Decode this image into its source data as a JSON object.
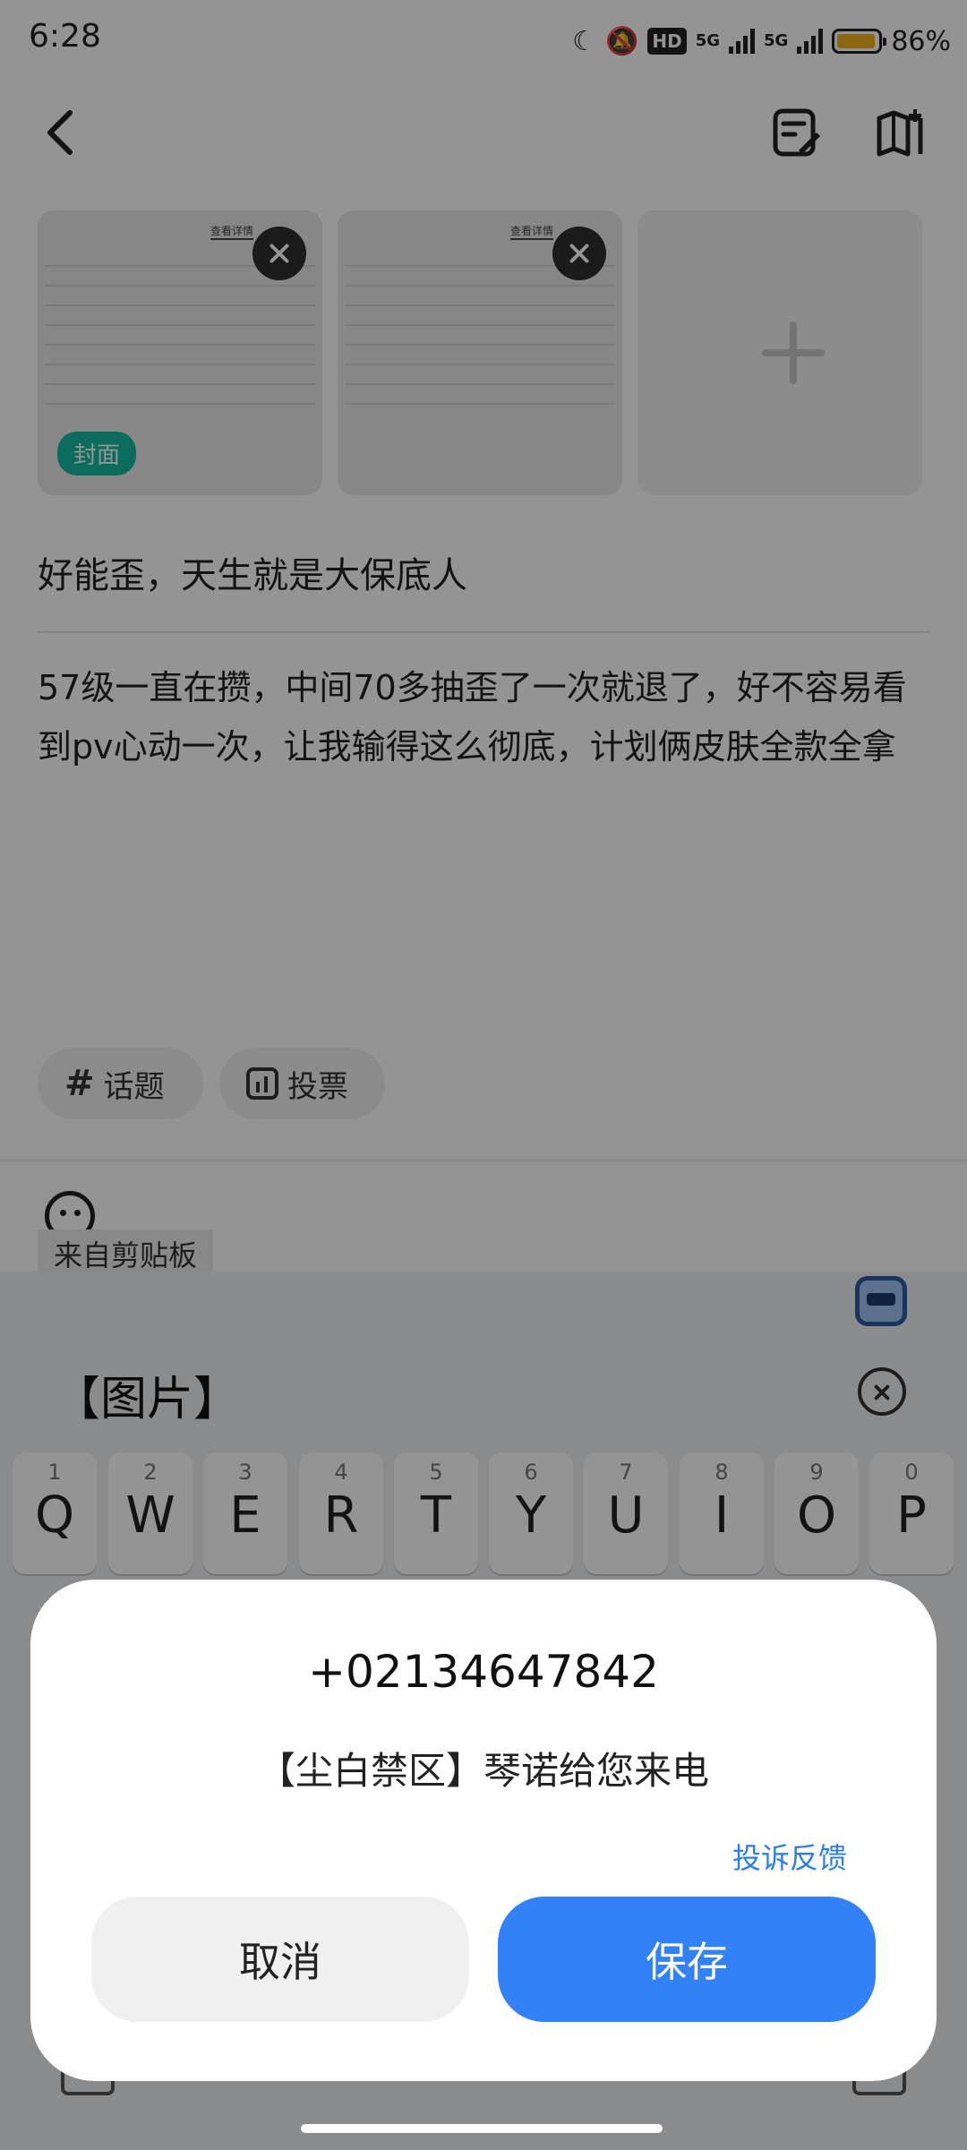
{
  "status_bar": {
    "time": "6:28",
    "hd": "HD",
    "net1": "5G",
    "net2": "5G",
    "battery": "86%"
  },
  "images": {
    "cover_label": "封面",
    "tabs": [
      "",
      "",
      "查看详情"
    ]
  },
  "post": {
    "title": "好能歪，天生就是大保底人",
    "body": "57级一直在攒，中间70多抽歪了一次就退了，好不容易看到pv心动一次，让我输得这么彻底，计划俩皮肤全款全拿"
  },
  "chips": {
    "topic": "话题",
    "vote": "投票"
  },
  "clipboard": {
    "label": "来自剪贴板",
    "item": "【图片】"
  },
  "keyboard": {
    "keys": [
      {
        "num": "1",
        "letter": "Q"
      },
      {
        "num": "2",
        "letter": "W"
      },
      {
        "num": "3",
        "letter": "E"
      },
      {
        "num": "4",
        "letter": "R"
      },
      {
        "num": "5",
        "letter": "T"
      },
      {
        "num": "6",
        "letter": "Y"
      },
      {
        "num": "7",
        "letter": "U"
      },
      {
        "num": "8",
        "letter": "I"
      },
      {
        "num": "9",
        "letter": "O"
      },
      {
        "num": "0",
        "letter": "P"
      }
    ]
  },
  "dialog": {
    "phone": "+02134647842",
    "message": "【尘白禁区】琴诺给您来电",
    "report": "投诉反馈",
    "cancel": "取消",
    "save": "保存"
  },
  "colors": {
    "accent": "#3381f6",
    "link": "#2b7de9",
    "cover_badge": "#14b8a0"
  }
}
